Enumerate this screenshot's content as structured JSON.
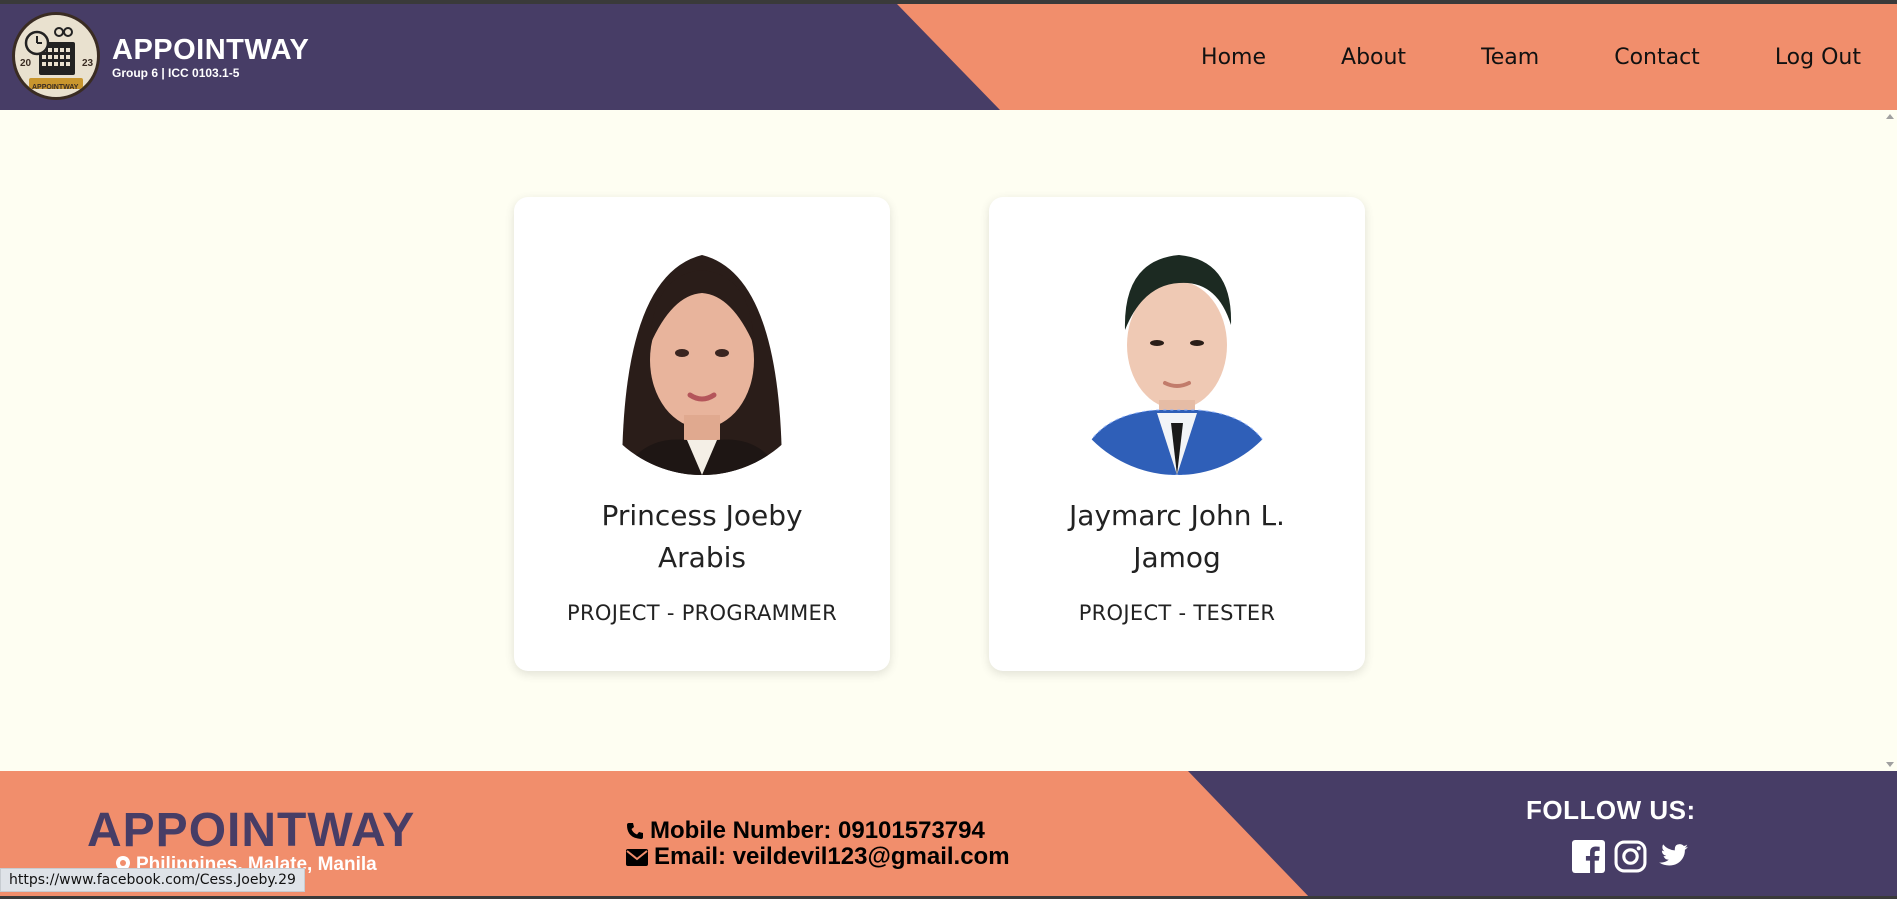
{
  "header": {
    "brand_title": "APPOINTWAY",
    "brand_subtitle": "Group 6 | ICC 0103.1-5",
    "logo_text": {
      "year_left": "20",
      "year_right": "23",
      "ribbon": "APPOINTWAY"
    },
    "nav": [
      {
        "label": "Home"
      },
      {
        "label": "About"
      },
      {
        "label": "Team"
      },
      {
        "label": "Contact"
      },
      {
        "label": "Log Out"
      }
    ]
  },
  "team": [
    {
      "name_line1": "Princess Joeby",
      "name_line2": "Arabis",
      "role": "PROJECT - PROGRAMMER"
    },
    {
      "name_line1": "Jaymarc John L.",
      "name_line2": "Jamog",
      "role": "PROJECT - TESTER"
    }
  ],
  "footer": {
    "brand": "APPOINTWAY",
    "location": "Philippines, Malate, Manila",
    "mobile": "Mobile Number: 09101573794",
    "email": "Email: veildevil123@gmail.com",
    "follow_label": "FOLLOW US:",
    "socials": [
      "facebook-icon",
      "instagram-icon",
      "twitter-icon"
    ]
  },
  "status_bar": {
    "url": "https://www.facebook.com/Cess.Joeby.29"
  },
  "colors": {
    "primary_purple": "#473d66",
    "accent_orange": "#f18e6c",
    "background": "#fefef2"
  }
}
